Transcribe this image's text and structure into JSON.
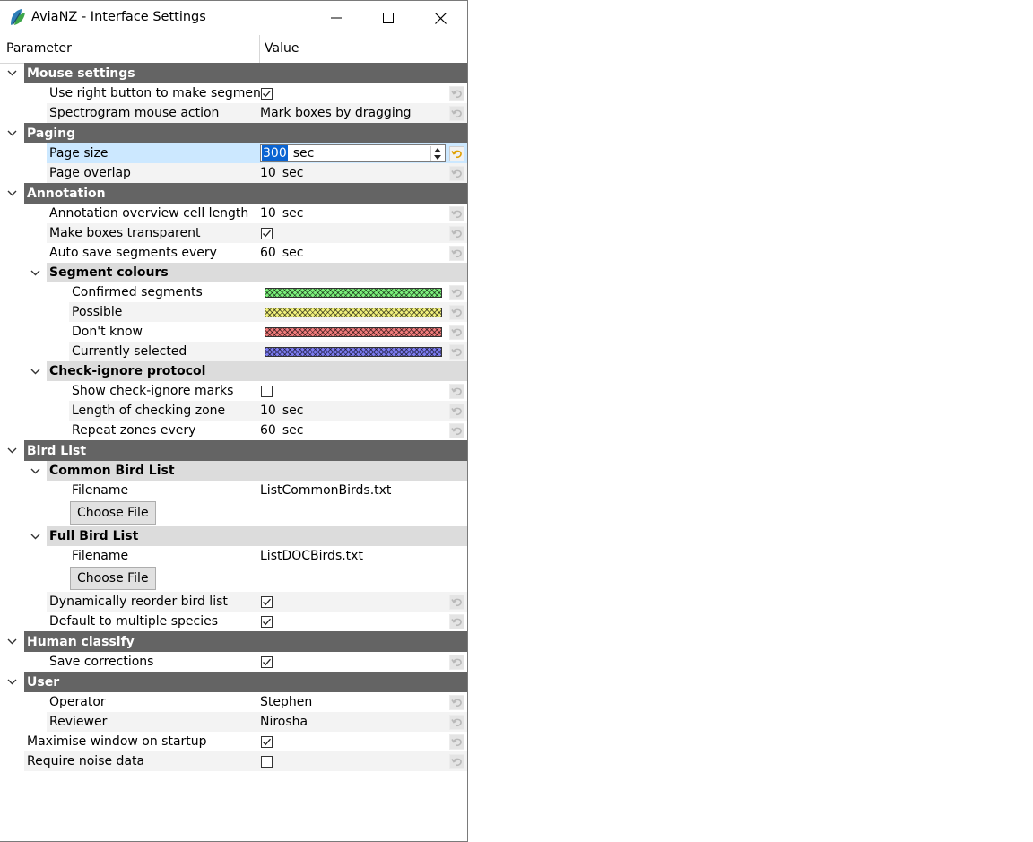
{
  "window": {
    "title": "AviaNZ - Interface Settings"
  },
  "header": {
    "parameter": "Parameter",
    "value": "Value"
  },
  "colors": {
    "group_bg": "#646464",
    "subgroup_bg": "#dcdcdc",
    "alt_row": "#f3f3f3",
    "selected_row": "#cce8ff",
    "green": "#7bf07b",
    "yellow": "#f0f07b",
    "red": "#f07b7b",
    "blue": "#7b7bf0"
  },
  "rows": [
    {
      "type": "group",
      "name": "Mouse settings"
    },
    {
      "type": "check",
      "name": "Use right button to make segments",
      "checked": true
    },
    {
      "type": "text",
      "name": "Spectrogram mouse action",
      "value": "Mark boxes by dragging"
    },
    {
      "type": "group",
      "name": "Paging"
    },
    {
      "type": "spin",
      "name": "Page size",
      "value": "300",
      "unit": "sec",
      "selected": true
    },
    {
      "type": "num",
      "name": "Page overlap",
      "value": "10",
      "unit": "sec"
    },
    {
      "type": "group",
      "name": "Annotation"
    },
    {
      "type": "num",
      "name": "Annotation overview cell length",
      "value": "10",
      "unit": "sec"
    },
    {
      "type": "check",
      "name": "Make boxes transparent",
      "checked": true
    },
    {
      "type": "num",
      "name": "Auto save segments every",
      "value": "60",
      "unit": "sec"
    },
    {
      "type": "subgroup",
      "name": "Segment colours"
    },
    {
      "type": "color",
      "name": "Confirmed segments",
      "color": "#7bf07b"
    },
    {
      "type": "color",
      "name": "Possible",
      "color": "#f0f07b"
    },
    {
      "type": "color",
      "name": "Don't know",
      "color": "#f07b7b"
    },
    {
      "type": "color",
      "name": "Currently selected",
      "color": "#7b7bf0"
    },
    {
      "type": "subgroup",
      "name": "Check-ignore protocol"
    },
    {
      "type": "check",
      "name": "Show check-ignore marks",
      "checked": false
    },
    {
      "type": "num",
      "name": "Length of checking zone",
      "value": "10",
      "unit": "sec"
    },
    {
      "type": "num",
      "name": "Repeat zones every",
      "value": "60",
      "unit": "sec"
    },
    {
      "type": "group",
      "name": "Bird List"
    },
    {
      "type": "subgroup",
      "name": "Common Bird List"
    },
    {
      "type": "file",
      "name": "Filename",
      "value": "ListCommonBirds.txt"
    },
    {
      "type": "button",
      "name": "Choose File"
    },
    {
      "type": "subgroup",
      "name": "Full Bird List"
    },
    {
      "type": "file",
      "name": "Filename",
      "value": "ListDOCBirds.txt"
    },
    {
      "type": "button",
      "name": "Choose File"
    },
    {
      "type": "check",
      "name": "Dynamically reorder bird list",
      "checked": true
    },
    {
      "type": "check",
      "name": "Default to multiple species",
      "checked": true
    },
    {
      "type": "group",
      "name": "Human classify"
    },
    {
      "type": "check",
      "name": "Save corrections",
      "checked": true
    },
    {
      "type": "group",
      "name": "User"
    },
    {
      "type": "text",
      "name": "Operator",
      "value": "Stephen"
    },
    {
      "type": "text",
      "name": "Reviewer",
      "value": "Nirosha"
    },
    {
      "type": "check",
      "name": "Maximise window on startup",
      "checked": true
    },
    {
      "type": "check",
      "name": "Require noise data",
      "checked": false
    }
  ]
}
